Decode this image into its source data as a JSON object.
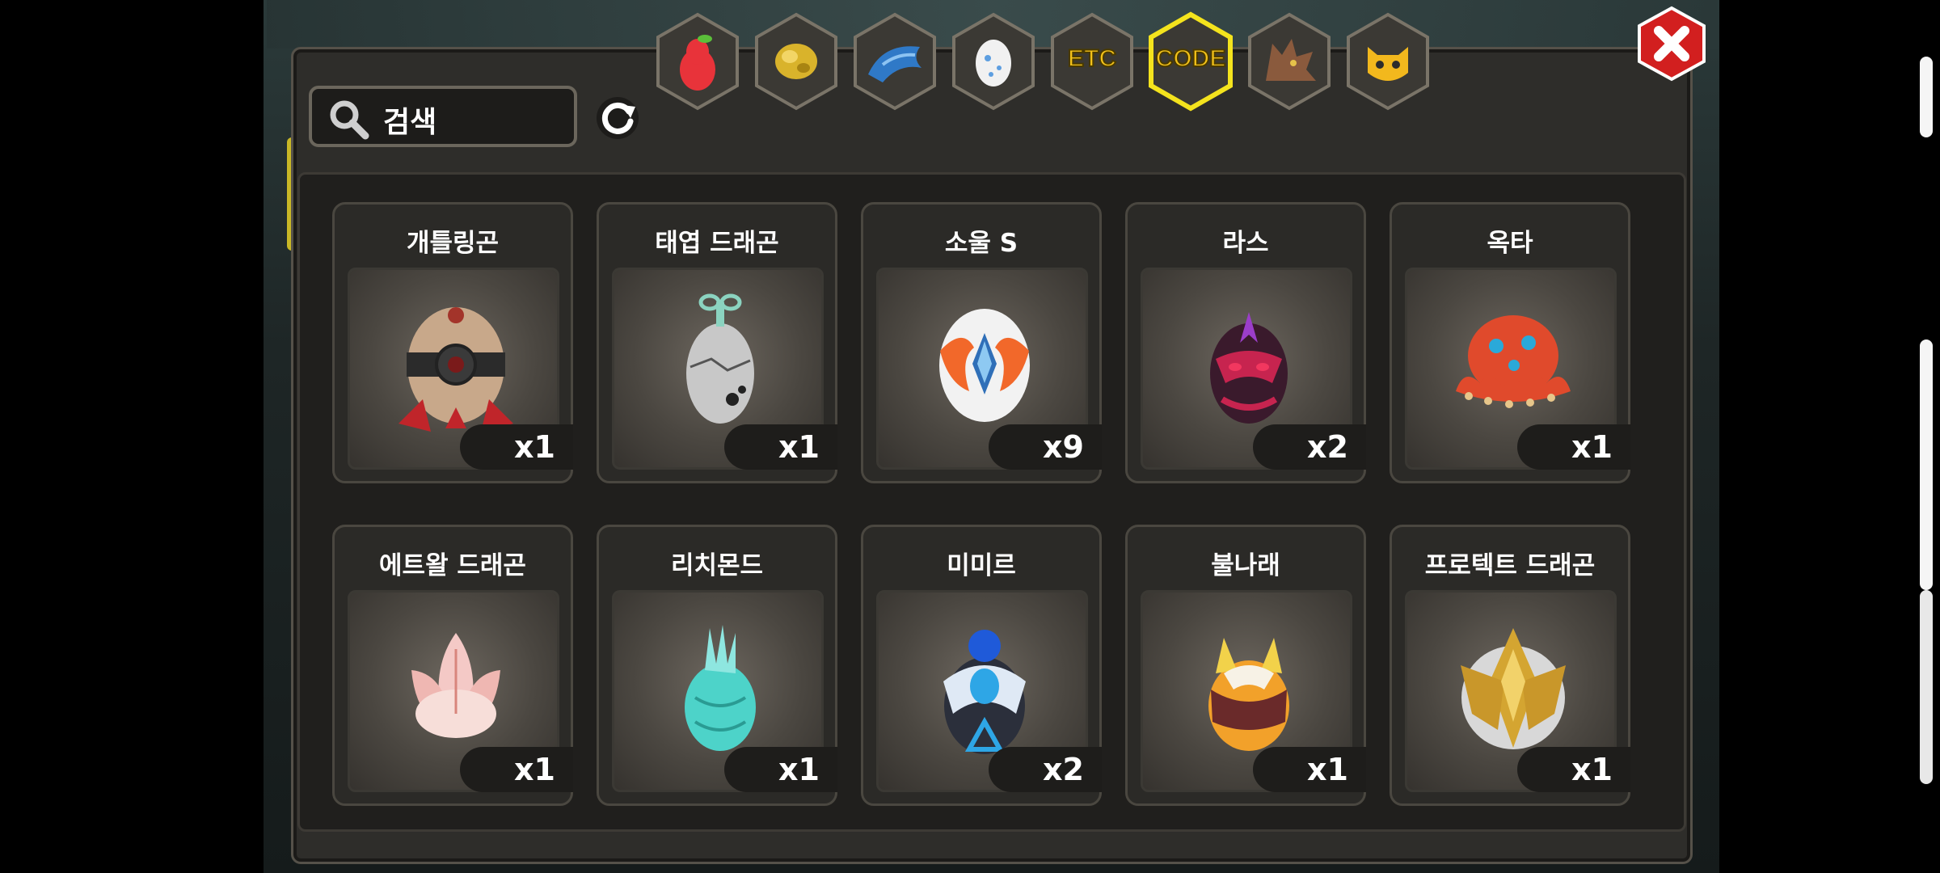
{
  "search": {
    "placeholder": "검색"
  },
  "tabs": [
    {
      "id": "fruit",
      "icon": "pear-icon",
      "label": ""
    },
    {
      "id": "gold",
      "icon": "gold-nugget-icon",
      "label": ""
    },
    {
      "id": "dragon",
      "icon": "blue-dragon-icon",
      "label": ""
    },
    {
      "id": "egg",
      "icon": "egg-icon",
      "label": ""
    },
    {
      "id": "etc",
      "icon": "",
      "label": "ETC"
    },
    {
      "id": "code",
      "icon": "",
      "label": "CODE",
      "selected": true
    },
    {
      "id": "werewolf",
      "icon": "werewolf-icon",
      "label": ""
    },
    {
      "id": "monster",
      "icon": "yellow-monster-icon",
      "label": ""
    }
  ],
  "items": [
    {
      "name": "개틀링곤",
      "count": "x1",
      "icon": "gatlinggon-egg-icon"
    },
    {
      "name": "태엽 드래곤",
      "count": "x1",
      "icon": "windup-dragon-egg-icon"
    },
    {
      "name": "소울 S",
      "count": "x9",
      "icon": "soul-s-egg-icon"
    },
    {
      "name": "라스",
      "count": "x2",
      "icon": "ras-egg-icon"
    },
    {
      "name": "옥타",
      "count": "x1",
      "icon": "octa-egg-icon"
    },
    {
      "name": "에트왈 드래곤",
      "count": "x1",
      "icon": "etoile-dragon-egg-icon"
    },
    {
      "name": "리치몬드",
      "count": "x1",
      "icon": "richmond-egg-icon"
    },
    {
      "name": "미미르",
      "count": "x2",
      "icon": "mimir-egg-icon"
    },
    {
      "name": "불나래",
      "count": "x1",
      "icon": "bulnarae-egg-icon"
    },
    {
      "name": "프로텍트 드래곤",
      "count": "x1",
      "icon": "protect-dragon-egg-icon"
    }
  ],
  "colors": {
    "accent": "#f3c21a",
    "close": "#d21f1f",
    "panel": "#2e2d2a"
  }
}
